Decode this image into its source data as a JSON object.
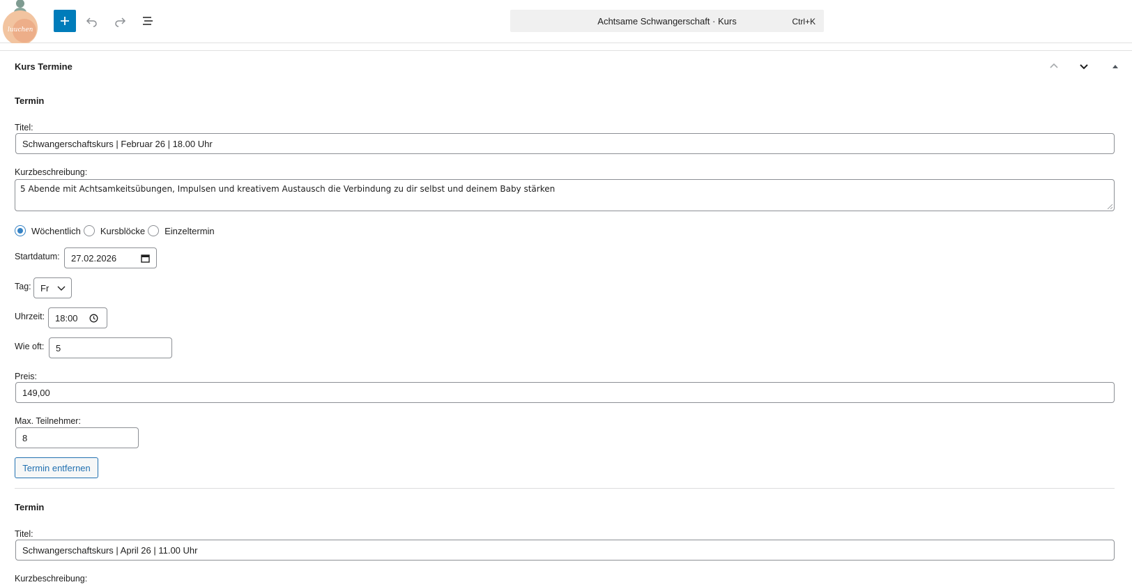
{
  "toolbar": {
    "logo_text": "luuchen",
    "add_icon": "plus-icon",
    "undo_icon": "undo-icon",
    "redo_icon": "redo-icon",
    "list_icon": "list-view-icon",
    "command": {
      "title": "Achtsame Schwangerschaft · Kurs",
      "shortcut": "Ctrl+K"
    }
  },
  "panel": {
    "title": "Kurs Termine",
    "controls": [
      "chevron-up-icon",
      "chevron-down-icon",
      "triangle-up-icon"
    ]
  },
  "termin1": {
    "heading": "Termin",
    "title_label": "Titel:",
    "title_value": "Schwangerschaftskurs | Februar 26 | 18.00 Uhr",
    "desc_label": "Kurzbeschreibung:",
    "desc_value": "5 Abende mit Achtsamkeitsübungen, Impulsen und kreativem Austausch die Verbindung zu dir selbst und deinem Baby stärken",
    "radios": [
      {
        "label": "Wöchentlich",
        "checked": true
      },
      {
        "label": "Kursblöcke",
        "checked": false
      },
      {
        "label": "Einzeltermin",
        "checked": false
      }
    ],
    "start_label": "Startdatum:",
    "start_value": "27.02.2026",
    "day_label": "Tag:",
    "day_value": "Fr",
    "time_label": "Uhrzeit:",
    "time_value": "18:00",
    "freq_label": "Wie oft:",
    "freq_value": "5",
    "price_label": "Preis:",
    "price_value": "149,00",
    "max_label": "Max. Teilnehmer:",
    "max_value": "8",
    "remove_label": "Termin entfernen"
  },
  "termin2": {
    "heading": "Termin",
    "title_label": "Titel:",
    "title_value": "Schwangerschaftskurs | April 26 | 11.00 Uhr",
    "desc_label": "Kurzbeschreibung:"
  },
  "colors": {
    "accent": "#007cba",
    "link": "#2271b1",
    "radio": "#3582c4"
  }
}
